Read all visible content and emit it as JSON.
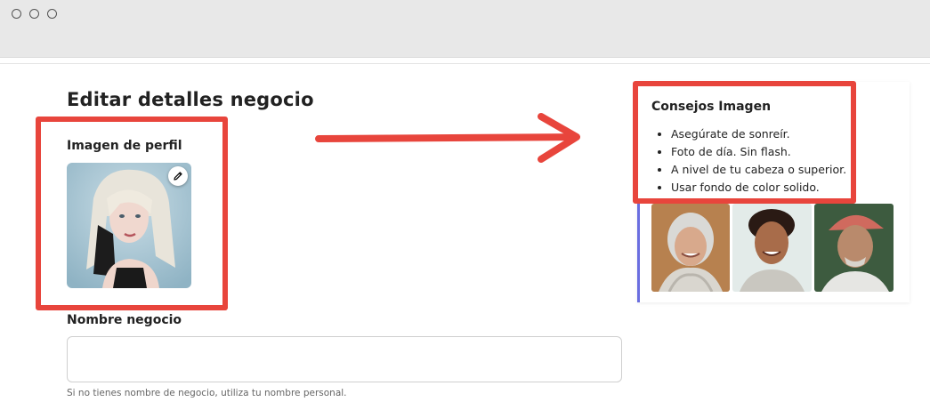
{
  "window": {
    "title_dots": 3
  },
  "form": {
    "title": "Editar detalles negocio",
    "profile_image_label": "Imagen de perfil",
    "business_name_label": "Nombre negocio",
    "business_name_value": "",
    "business_name_helper": "Si no tienes nombre de negocio, utiliza tu nombre personal."
  },
  "tips": {
    "title": "Consejos Imagen",
    "items": [
      "Asegúrate de sonreír.",
      "Foto de día. Sin flash.",
      "A nivel de tu cabeza o superior.",
      "Usar fondo de color solido."
    ]
  },
  "colors": {
    "annotation_red": "#e8453c",
    "tips_accent": "#6a6ee0",
    "titlebar": "#e8e8e8"
  },
  "icons": [
    "pencil-icon",
    "window-dot"
  ]
}
